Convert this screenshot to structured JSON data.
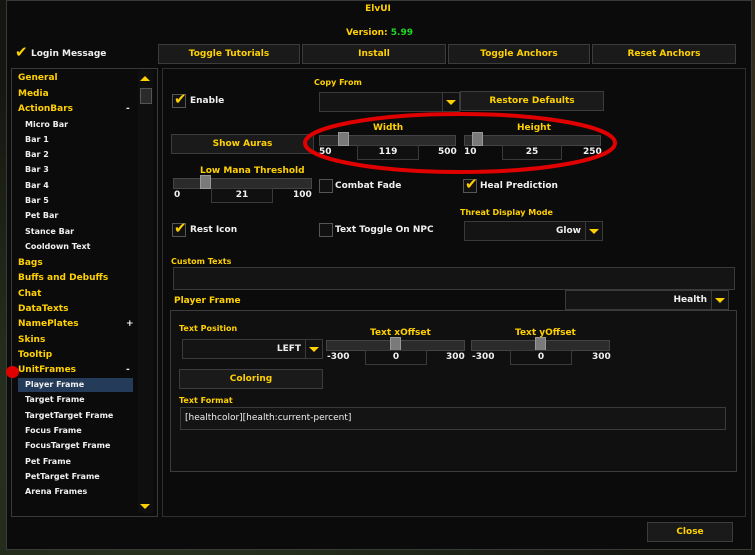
{
  "window": {
    "title": "ElvUI",
    "version_label": "Version:",
    "version_value": "5.99"
  },
  "top": {
    "login_message": "Login Message",
    "tabs": [
      "Toggle Tutorials",
      "Install",
      "Toggle Anchors",
      "Reset Anchors"
    ]
  },
  "nav": {
    "general": "General",
    "media": "Media",
    "actionbars": "ActionBars",
    "actionbars_sign": "-",
    "actionbars_items": [
      "Micro Bar",
      "Bar 1",
      "Bar 2",
      "Bar 3",
      "Bar 4",
      "Bar 5",
      "Pet Bar",
      "Stance Bar",
      "Cooldown Text"
    ],
    "bags": "Bags",
    "buffs": "Buffs and Debuffs",
    "chat": "Chat",
    "datatexts": "DataTexts",
    "nameplates": "NamePlates",
    "nameplates_sign": "+",
    "skins": "Skins",
    "tooltip": "Tooltip",
    "unitframes": "UnitFrames",
    "unitframes_sign": "-",
    "unitframes_items": [
      "Player Frame",
      "Target Frame",
      "TargetTarget Frame",
      "Focus Frame",
      "FocusTarget Frame",
      "Pet Frame",
      "PetTarget Frame",
      "Arena Frames"
    ]
  },
  "content": {
    "enable": "Enable",
    "copy_from": "Copy From",
    "restore_defaults": "Restore Defaults",
    "show_auras": "Show Auras",
    "width": {
      "label": "Width",
      "min": "50",
      "value": "119",
      "max": "500",
      "fraction": 0.15
    },
    "height": {
      "label": "Height",
      "min": "10",
      "value": "25",
      "max": "250",
      "fraction": 0.06
    },
    "low_mana": {
      "label": "Low Mana Threshold",
      "min": "0",
      "value": "21",
      "max": "100",
      "fraction": 0.21
    },
    "combat_fade": "Combat Fade",
    "heal_prediction": "Heal Prediction",
    "threat_mode": {
      "label": "Threat Display Mode",
      "value": "Glow"
    },
    "rest_icon": "Rest Icon",
    "text_toggle_npc": "Text Toggle On NPC",
    "custom_texts": "Custom Texts",
    "player_frame": {
      "label": "Player Frame",
      "dropdown": "Health"
    },
    "text_position": {
      "label": "Text Position",
      "value": "LEFT"
    },
    "text_xoffset": {
      "label": "Text xOffset",
      "min": "-300",
      "value": "0",
      "max": "300",
      "fraction": 0.5
    },
    "text_yoffset": {
      "label": "Text yOffset",
      "min": "-300",
      "value": "0",
      "max": "300",
      "fraction": 0.5
    },
    "coloring": "Coloring",
    "text_format": {
      "label": "Text Format",
      "value": "[healthcolor][health:current-percent]"
    }
  },
  "footer": {
    "close": "Close"
  },
  "annotation": {
    "color": "#e10000"
  }
}
